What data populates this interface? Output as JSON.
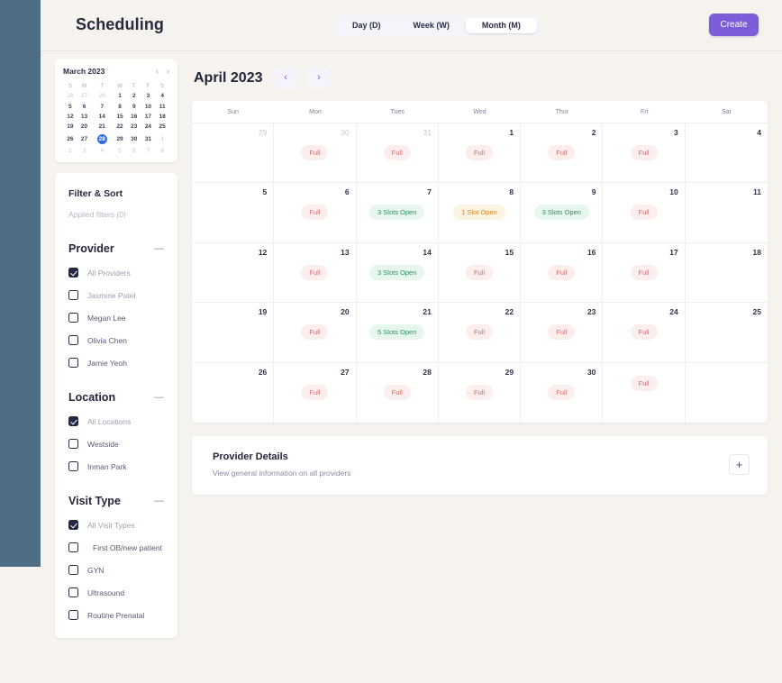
{
  "header": {
    "app_title": "Scheduling",
    "view_tabs": [
      {
        "label": "Day (D)",
        "active": false
      },
      {
        "label": "Week (W)",
        "active": false
      },
      {
        "label": "Month (M)",
        "active": true
      }
    ],
    "create_label": "Create",
    "accent_color": "#7c5cd8"
  },
  "mini_calendar": {
    "title": "March 2023",
    "prev_icon": "chevron-left-icon",
    "next_icon": "chevron-right-icon",
    "dow": [
      "S",
      "M",
      "T",
      "W",
      "T",
      "F",
      "S"
    ],
    "selected_day": 28,
    "weeks": [
      [
        {
          "d": 26,
          "out": true
        },
        {
          "d": 27,
          "out": true
        },
        {
          "d": 28,
          "out": true
        },
        {
          "d": 1
        },
        {
          "d": 2
        },
        {
          "d": 3
        },
        {
          "d": 4
        }
      ],
      [
        {
          "d": 5
        },
        {
          "d": 6
        },
        {
          "d": 7
        },
        {
          "d": 8
        },
        {
          "d": 9
        },
        {
          "d": 10
        },
        {
          "d": 11
        }
      ],
      [
        {
          "d": 12
        },
        {
          "d": 13
        },
        {
          "d": 14
        },
        {
          "d": 15
        },
        {
          "d": 16
        },
        {
          "d": 17
        },
        {
          "d": 18
        }
      ],
      [
        {
          "d": 19
        },
        {
          "d": 20
        },
        {
          "d": 21
        },
        {
          "d": 22
        },
        {
          "d": 23
        },
        {
          "d": 24
        },
        {
          "d": 25
        }
      ],
      [
        {
          "d": 26
        },
        {
          "d": 27
        },
        {
          "d": 28,
          "sel": true
        },
        {
          "d": 29
        },
        {
          "d": 30
        },
        {
          "d": 31
        },
        {
          "d": 1,
          "out": true
        }
      ],
      [
        {
          "d": 2,
          "out": true
        },
        {
          "d": 3,
          "out": true
        },
        {
          "d": 4,
          "out": true
        },
        {
          "d": 5,
          "out": true
        },
        {
          "d": 6,
          "out": true
        },
        {
          "d": 7,
          "out": true
        },
        {
          "d": 8,
          "out": true
        }
      ]
    ]
  },
  "filters": {
    "title": "Filter & Sort",
    "applied_text": "Applied filters (0)",
    "collapse_icon": "minus-icon",
    "groups": [
      {
        "name": "Provider",
        "title": "Provider",
        "items": [
          {
            "label": "All Providers",
            "checked": true,
            "muted": true
          },
          {
            "label": "Jasmine Patel",
            "checked": false,
            "muted": true
          },
          {
            "label": "Megan Lee",
            "checked": false,
            "muted": false
          },
          {
            "label": "Olivia Chen",
            "checked": false,
            "muted": false
          },
          {
            "label": "Jamie Yeoh",
            "checked": false,
            "muted": false
          }
        ]
      },
      {
        "name": "Location",
        "title": "Location",
        "items": [
          {
            "label": "All Locations",
            "checked": true,
            "muted": true
          },
          {
            "label": "Westside",
            "checked": false,
            "muted": false
          },
          {
            "label": "Inman Park",
            "checked": false,
            "muted": false
          }
        ]
      },
      {
        "name": "Visit Type",
        "title": "Visit Type",
        "items": [
          {
            "label": "All Visit Types",
            "checked": true,
            "muted": true
          },
          {
            "label": "First OB/new patient",
            "checked": false,
            "muted": false,
            "indent": true
          },
          {
            "label": "GYN",
            "checked": false,
            "muted": false
          },
          {
            "label": "Ultrasound",
            "checked": false,
            "muted": false
          },
          {
            "label": "Routine Prenatal",
            "checked": false,
            "muted": false
          }
        ]
      }
    ]
  },
  "calendar": {
    "month_title": "April 2023",
    "prev_icon": "chevron-left-icon",
    "next_icon": "chevron-right-icon",
    "dow": [
      "Sun",
      "Mon",
      "Tues",
      "Wed",
      "Thur",
      "Fri",
      "Sat"
    ],
    "badge_colors": {
      "full_bg": "#fdeeee",
      "full_fg": "#d36a6a",
      "open_bg": "#e7f7ed",
      "open_fg": "#23935c",
      "low_bg": "#fdf3e1",
      "low_fg": "#d2882c"
    },
    "cells": [
      {
        "day": "29",
        "out": true
      },
      {
        "day": "30",
        "out": true,
        "badge": "Full",
        "type": "full"
      },
      {
        "day": "31",
        "out": true,
        "badge": "Full",
        "type": "full"
      },
      {
        "day": "1",
        "badge": "Full",
        "type": "full"
      },
      {
        "day": "2",
        "badge": "Full",
        "type": "full"
      },
      {
        "day": "3",
        "badge": "Full",
        "type": "full"
      },
      {
        "day": "4"
      },
      {
        "day": "5"
      },
      {
        "day": "6",
        "badge": "Full",
        "type": "full"
      },
      {
        "day": "7",
        "badge": "3 Slots Open",
        "type": "open"
      },
      {
        "day": "8",
        "badge": "1 Slot Open",
        "type": "low"
      },
      {
        "day": "9",
        "badge": "3 Slots Open",
        "type": "open"
      },
      {
        "day": "10",
        "badge": "Full",
        "type": "full"
      },
      {
        "day": "11"
      },
      {
        "day": "12"
      },
      {
        "day": "13",
        "badge": "Full",
        "type": "full"
      },
      {
        "day": "14",
        "badge": "3 Slots Open",
        "type": "open"
      },
      {
        "day": "15",
        "badge": "Full",
        "type": "full"
      },
      {
        "day": "16",
        "badge": "Full",
        "type": "full"
      },
      {
        "day": "17",
        "badge": "Full",
        "type": "full"
      },
      {
        "day": "18"
      },
      {
        "day": "19"
      },
      {
        "day": "20",
        "badge": "Full",
        "type": "full"
      },
      {
        "day": "21",
        "badge": "5 Slots Open",
        "type": "open"
      },
      {
        "day": "22",
        "badge": "Full",
        "type": "full"
      },
      {
        "day": "23",
        "badge": "Full",
        "type": "full"
      },
      {
        "day": "24",
        "badge": "Full",
        "type": "full"
      },
      {
        "day": "25"
      },
      {
        "day": "26"
      },
      {
        "day": "27",
        "badge": "Full",
        "type": "full"
      },
      {
        "day": "28",
        "badge": "Full",
        "type": "full"
      },
      {
        "day": "29",
        "badge": "Full",
        "type": "full"
      },
      {
        "day": "30",
        "badge": "Full",
        "type": "full"
      },
      {
        "day": "",
        "badge": "Full",
        "type": "full"
      },
      {
        "day": ""
      }
    ]
  },
  "provider_details": {
    "title": "Provider Details",
    "subtitle": "View general information on all providers",
    "expand_icon": "plus-icon"
  }
}
